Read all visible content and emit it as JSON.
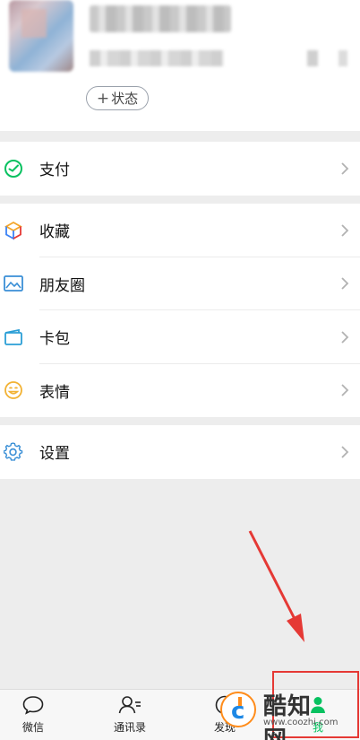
{
  "profile": {
    "status_button": "状态",
    "status_plus": "+"
  },
  "menu": {
    "pay": {
      "label": "支付"
    },
    "favorites": {
      "label": "收藏"
    },
    "moments": {
      "label": "朋友圈"
    },
    "cards": {
      "label": "卡包"
    },
    "stickers": {
      "label": "表情"
    },
    "settings": {
      "label": "设置"
    }
  },
  "tabbar": {
    "chats": "微信",
    "contacts": "通讯录",
    "discover": "发现",
    "me": "我"
  },
  "watermark": {
    "brand": "酷知网",
    "url": "www.coozhi.com"
  },
  "colors": {
    "wechat_green": "#07c160",
    "annotation_red": "#e53935"
  },
  "icons": {
    "pay": "wechat-pay-icon",
    "favorites": "cube-icon",
    "moments": "image-icon",
    "cards": "wallet-icon",
    "stickers": "smiley-icon",
    "settings": "gear-icon"
  }
}
